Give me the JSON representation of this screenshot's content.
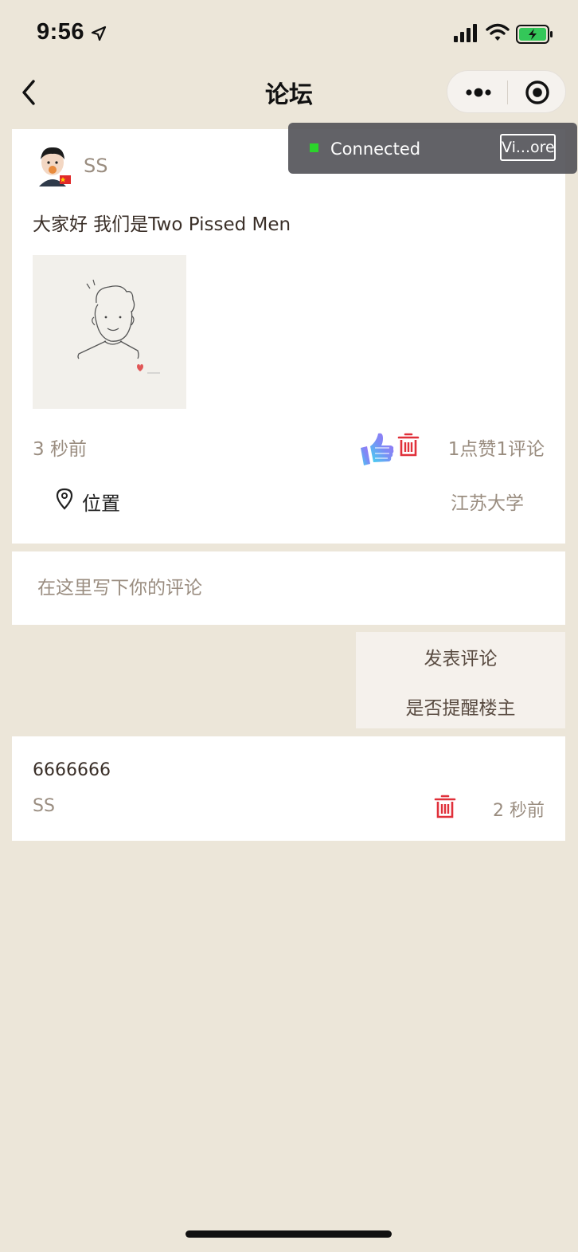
{
  "status_bar": {
    "time": "9:56"
  },
  "nav": {
    "title": "论坛"
  },
  "toast": {
    "text": "Connected",
    "button_label": "Vi...ore"
  },
  "post": {
    "author": "SS",
    "text": "大家好 我们是Two Pissed Men",
    "time": "3 秒前",
    "stats": "1点赞1评论",
    "location_label": "位置",
    "location_value": "江苏大学"
  },
  "comment_form": {
    "placeholder": "在这里写下你的评论",
    "value": "",
    "publish_label": "发表评论",
    "remind_label": "是否提醒楼主"
  },
  "comments": [
    {
      "text": "6666666",
      "author": "SS",
      "time": "2 秒前"
    }
  ],
  "colors": {
    "page_bg": "#ECE6D9",
    "card_bg": "#FFFFFF",
    "muted_text": "#9A8D80",
    "delete_red": "#E0303A",
    "toast_green": "#2BD42B"
  }
}
